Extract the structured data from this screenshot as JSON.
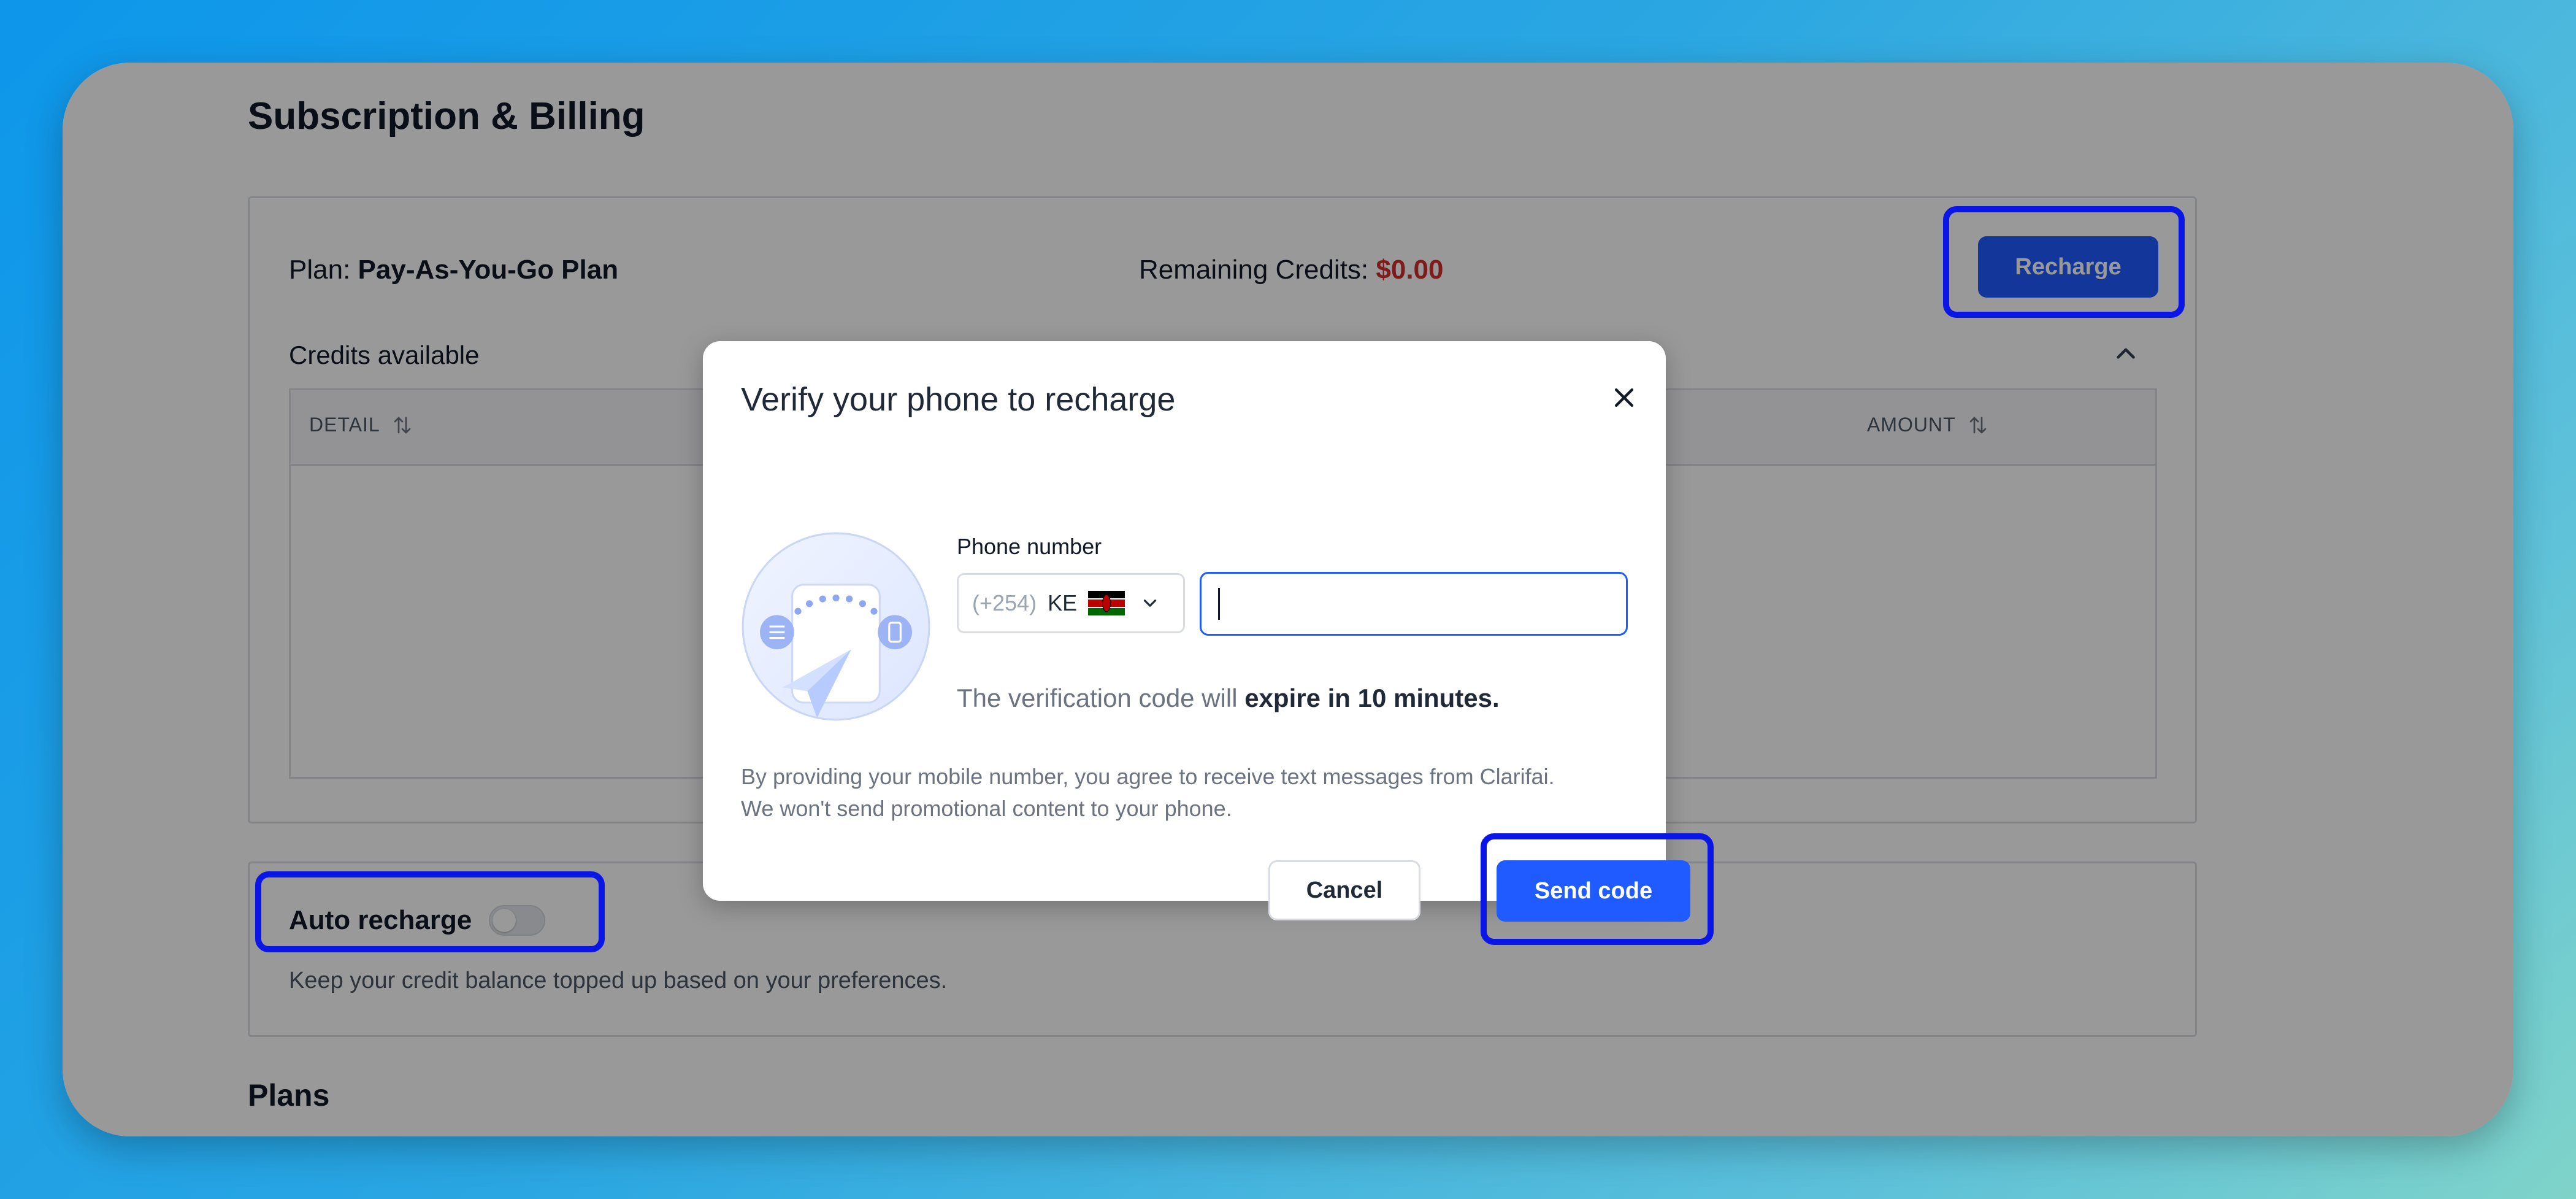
{
  "page": {
    "title": "Subscription & Billing",
    "plan": {
      "label": "Plan:",
      "value": "Pay-As-You-Go Plan",
      "credits_label": "Remaining Credits:",
      "credits_value": "$0.00",
      "recharge_button": "Recharge"
    },
    "credits_section": {
      "title": "Credits available",
      "columns": [
        "DETAIL",
        "AMOUNT"
      ]
    },
    "auto_recharge": {
      "label": "Auto recharge",
      "enabled": false,
      "description": "Keep your credit balance topped up based on your preferences."
    },
    "plans_heading": "Plans"
  },
  "modal": {
    "title": "Verify your phone to recharge",
    "phone_label": "Phone number",
    "dial_code": "(+254)",
    "country_code": "KE",
    "phone_value": "",
    "expiry_prefix": "The verification code will ",
    "expiry_bold": "expire in 10 minutes.",
    "disclaimer_line1": "By providing your mobile number, you agree to receive text messages from Clarifai.",
    "disclaimer_line2": "We won't send promotional content to your phone.",
    "cancel_button": "Cancel",
    "send_button": "Send code"
  },
  "colors": {
    "primary": "#1f5bff",
    "credits_negative": "#d32f2f",
    "highlight_outline": "#0a16e6"
  },
  "icons": [
    "close-icon",
    "chevron-up-icon",
    "chevron-down-icon",
    "sort-icon",
    "kenya-flag-icon"
  ]
}
